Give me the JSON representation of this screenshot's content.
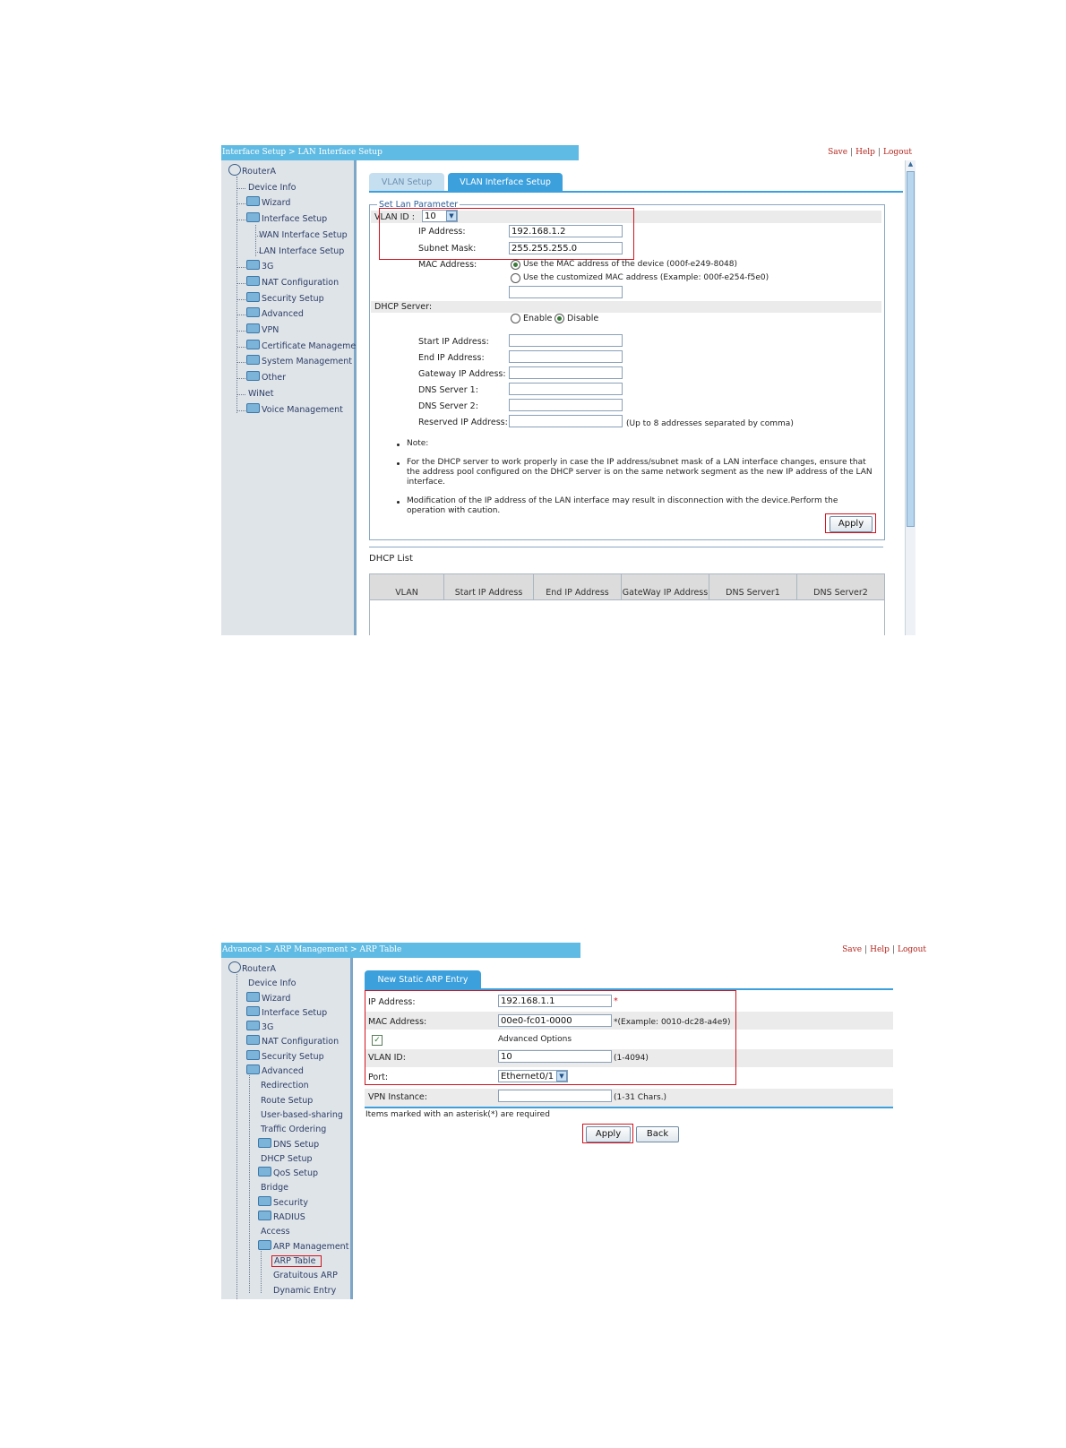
{
  "shot1": {
    "breadcrumb": "Interface Setup > LAN Interface Setup",
    "top_links": [
      "Save",
      "Help",
      "Logout"
    ],
    "tree": {
      "root": "RouterA",
      "items": [
        {
          "label": "Device Info",
          "icon": false
        },
        {
          "label": "Wizard",
          "icon": true
        },
        {
          "label": "Interface Setup",
          "icon": true
        },
        {
          "label": "WAN Interface Setup",
          "icon": false,
          "child": true
        },
        {
          "label": "LAN Interface Setup",
          "icon": false,
          "child": true
        },
        {
          "label": "3G",
          "icon": true
        },
        {
          "label": "NAT Configuration",
          "icon": true
        },
        {
          "label": "Security Setup",
          "icon": true
        },
        {
          "label": "Advanced",
          "icon": true
        },
        {
          "label": "VPN",
          "icon": true
        },
        {
          "label": "Certificate Managemer",
          "icon": true
        },
        {
          "label": "System Management",
          "icon": true
        },
        {
          "label": "Other",
          "icon": true
        },
        {
          "label": "WiNet",
          "icon": false
        },
        {
          "label": "Voice Management",
          "icon": true
        }
      ]
    },
    "tabs": [
      "VLAN Setup",
      "VLAN Interface Setup"
    ],
    "fieldset_legend": "Set Lan Parameter",
    "vlan_id_label": "VLAN ID :",
    "vlan_id_value": "10",
    "ip_label": "IP Address:",
    "ip_value": "192.168.1.2",
    "mask_label": "Subnet Mask:",
    "mask_value": "255.255.255.0",
    "mac_label": "MAC Address:",
    "mac_opt1": "Use the MAC address of the device (000f-e249-8048)",
    "mac_opt2": "Use the customized MAC address (Example: 000f-e254-f5e0)",
    "dhcp_label": "DHCP Server:",
    "dhcp_enable": "Enable",
    "dhcp_disable": "Disable",
    "start_ip": "Start IP Address:",
    "end_ip": "End IP Address:",
    "gw_ip": "Gateway IP Address:",
    "dns1": "DNS Server 1:",
    "dns2": "DNS Server 2:",
    "reserved": "Reserved IP Address:",
    "reserved_hint": "(Up to 8 addresses separated by comma)",
    "note_title": "Note:",
    "note1": "For the DHCP server to work properly in case the IP address/subnet mask of a LAN interface changes, ensure that the address pool configured on the DHCP server is on the same network segment as the new IP address of the LAN interface.",
    "note2": "Modification of the IP address of the LAN interface may result in disconnection with the device.Perform the operation with caution.",
    "apply": "Apply",
    "dhcp_list": "DHCP List",
    "columns": [
      "VLAN",
      "Start IP Address",
      "End IP Address",
      "GateWay IP Address",
      "DNS Server1",
      "DNS Server2"
    ]
  },
  "shot2": {
    "breadcrumb": "Advanced > ARP Management > ARP Table",
    "top_links": [
      "Save",
      "Help",
      "Logout"
    ],
    "tree": {
      "root": "RouterA",
      "items": [
        {
          "label": "Device Info",
          "icon": false,
          "level": 1
        },
        {
          "label": "Wizard",
          "icon": true,
          "level": 1
        },
        {
          "label": "Interface Setup",
          "icon": true,
          "level": 1
        },
        {
          "label": "3G",
          "icon": true,
          "level": 1
        },
        {
          "label": "NAT Configuration",
          "icon": true,
          "level": 1
        },
        {
          "label": "Security Setup",
          "icon": true,
          "level": 1
        },
        {
          "label": "Advanced",
          "icon": true,
          "level": 1
        },
        {
          "label": "Redirection",
          "icon": false,
          "level": 2
        },
        {
          "label": "Route Setup",
          "icon": false,
          "level": 2
        },
        {
          "label": "User-based-sharing",
          "icon": false,
          "level": 2
        },
        {
          "label": "Traffic Ordering",
          "icon": false,
          "level": 2
        },
        {
          "label": "DNS Setup",
          "icon": true,
          "level": 2
        },
        {
          "label": "DHCP Setup",
          "icon": false,
          "level": 2
        },
        {
          "label": "QoS Setup",
          "icon": true,
          "level": 2
        },
        {
          "label": "Bridge",
          "icon": false,
          "level": 2
        },
        {
          "label": "Security",
          "icon": true,
          "level": 2
        },
        {
          "label": "RADIUS",
          "icon": true,
          "level": 2
        },
        {
          "label": "Access",
          "icon": false,
          "level": 2
        },
        {
          "label": "ARP Management",
          "icon": true,
          "level": 2
        },
        {
          "label": "ARP Table",
          "icon": false,
          "level": 3,
          "selected": true
        },
        {
          "label": "Gratuitous ARP",
          "icon": false,
          "level": 3
        },
        {
          "label": "Dynamic Entry",
          "icon": false,
          "level": 3
        }
      ]
    },
    "tab": "New Static ARP Entry",
    "ip_label": "IP Address:",
    "ip_value": "192.168.1.1",
    "ip_req": "*",
    "mac_label": "MAC Address:",
    "mac_value": "00e0-fc01-0000",
    "mac_hint": "*(Example: 0010-dc28-a4e9)",
    "adv_options": "Advanced Options",
    "vlan_label": "VLAN ID:",
    "vlan_value": "10",
    "vlan_hint": "(1-4094)",
    "port_label": "Port:",
    "port_value": "Ethernet0/1",
    "vpn_label": "VPN Instance:",
    "vpn_hint": "(1-31 Chars.)",
    "required_note": "Items marked with an asterisk(*) are required",
    "apply": "Apply",
    "back": "Back"
  }
}
